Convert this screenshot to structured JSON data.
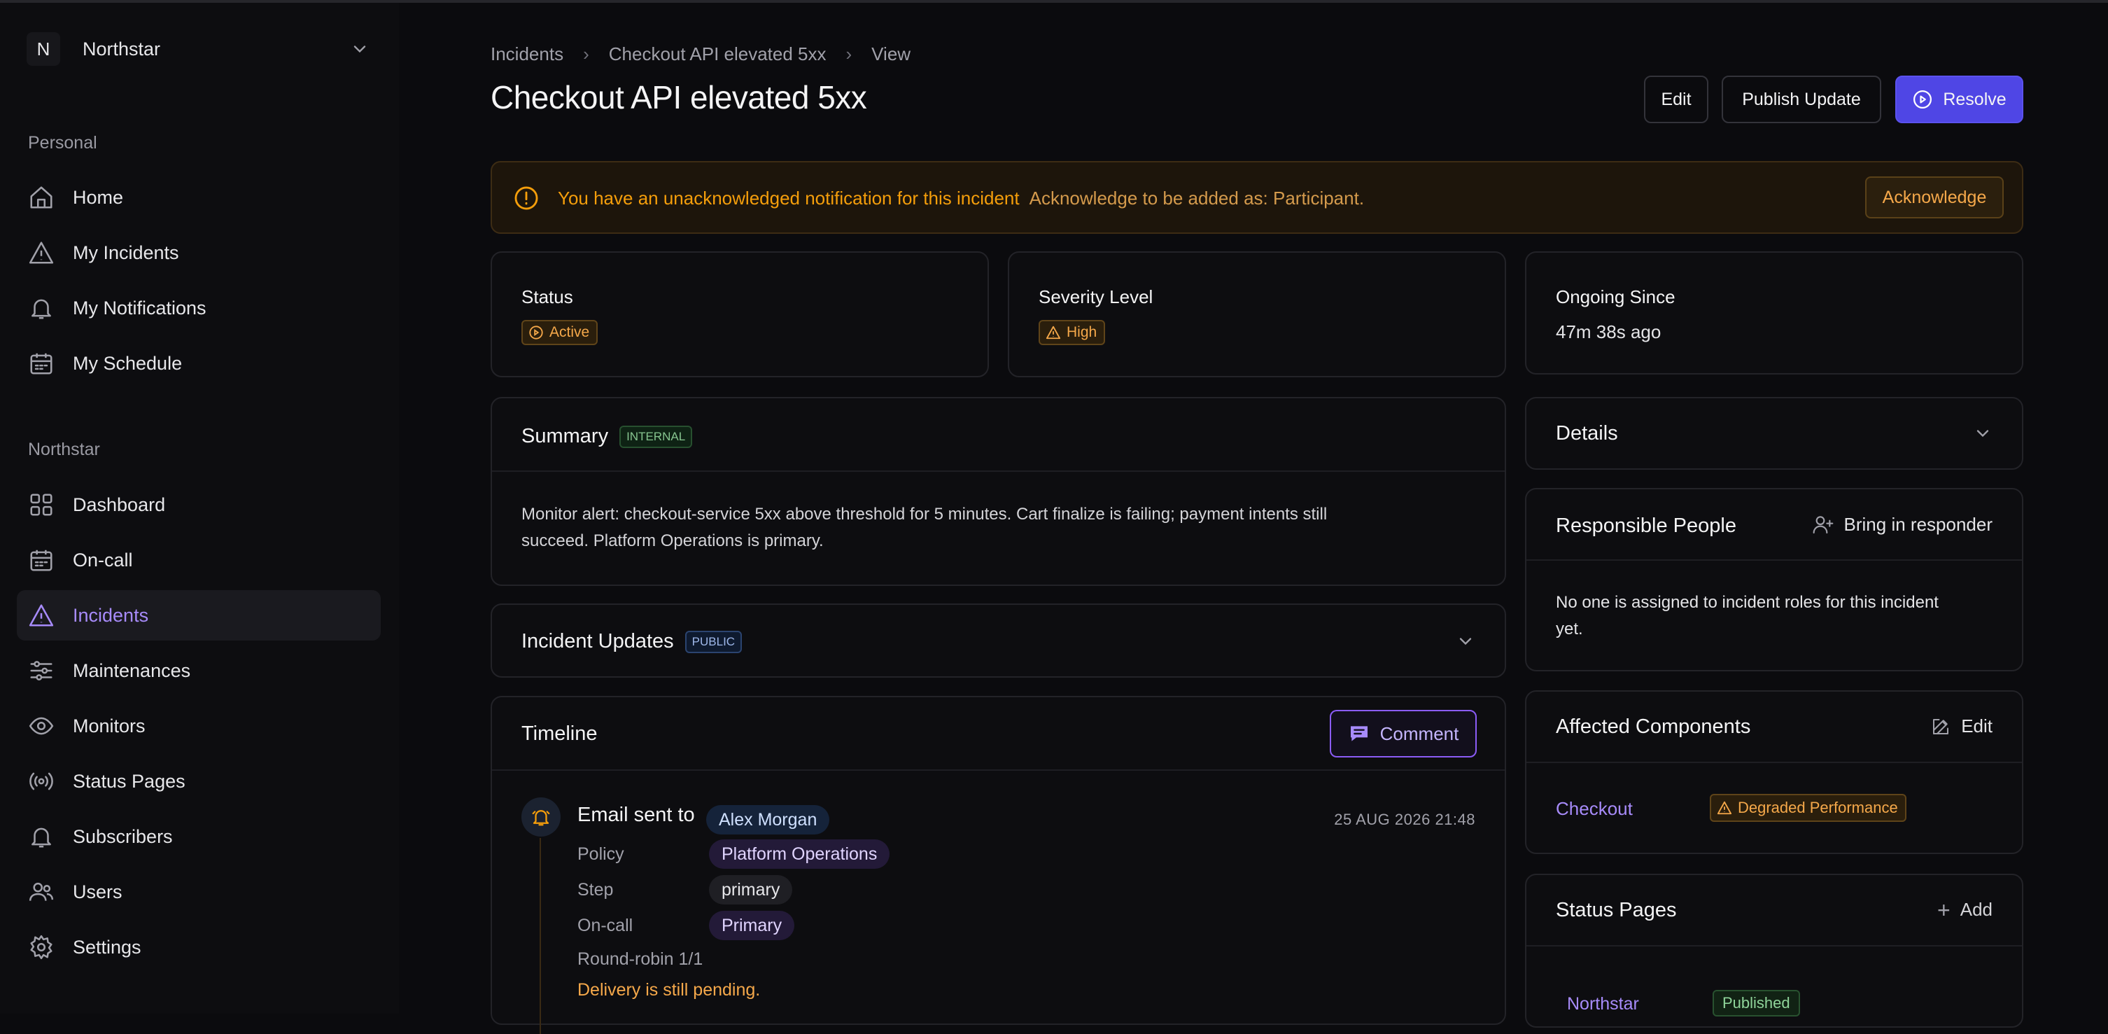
{
  "sidebar": {
    "org_initial": "N",
    "org_name": "Northstar",
    "personal_label": "Personal",
    "personal_items": [
      {
        "label": "Home",
        "icon": "home-icon"
      },
      {
        "label": "My Incidents",
        "icon": "warning-triangle-icon"
      },
      {
        "label": "My Notifications",
        "icon": "bell-icon"
      },
      {
        "label": "My Schedule",
        "icon": "calendar-icon"
      }
    ],
    "org_label": "Northstar",
    "org_items": [
      {
        "label": "Dashboard",
        "icon": "grid-icon"
      },
      {
        "label": "On-call",
        "icon": "calendar-icon"
      },
      {
        "label": "Incidents",
        "icon": "warning-triangle-icon",
        "active": true
      },
      {
        "label": "Maintenances",
        "icon": "sliders-icon"
      },
      {
        "label": "Monitors",
        "icon": "eye-icon"
      },
      {
        "label": "Status Pages",
        "icon": "broadcast-icon"
      },
      {
        "label": "Subscribers",
        "icon": "bell-icon"
      },
      {
        "label": "Users",
        "icon": "users-icon"
      },
      {
        "label": "Settings",
        "icon": "gear-icon"
      }
    ]
  },
  "breadcrumb": [
    "Incidents",
    "Checkout API elevated 5xx",
    "View"
  ],
  "header": {
    "title": "Checkout API elevated 5xx",
    "edit_label": "Edit",
    "publish_label": "Publish Update",
    "resolve_label": "Resolve"
  },
  "alert": {
    "message": "You have an unacknowledged notification for this incident",
    "detail": "Acknowledge to be added as: Participant.",
    "button": "Acknowledge"
  },
  "status": {
    "label": "Status",
    "value": "Active"
  },
  "severity": {
    "label": "Severity Level",
    "value": "High"
  },
  "ongoing": {
    "label": "Ongoing Since",
    "value": "47m 38s ago"
  },
  "summary": {
    "title": "Summary",
    "tag": "INTERNAL",
    "text_line1": "Monitor alert: checkout-service 5xx above threshold for 5 minutes. Cart finalize is failing; payment intents still",
    "text_line2": "succeed. Platform Operations is primary."
  },
  "updates": {
    "title": "Incident Updates",
    "tag": "PUBLIC"
  },
  "timeline": {
    "title": "Timeline",
    "comment_label": "Comment",
    "entry": {
      "heading": "Email sent to",
      "recipient": "Alex Morgan",
      "timestamp": "25 AUG 2026 21:48",
      "policy_label": "Policy",
      "policy_value": "Platform Operations",
      "step_label": "Step",
      "step_value": "primary",
      "oncall_label": "On-call",
      "oncall_value": "Primary",
      "round_robin": "Round-robin 1/1",
      "delivery": "Delivery is still pending."
    }
  },
  "details": {
    "title": "Details"
  },
  "responsible": {
    "title": "Responsible People",
    "action": "Bring in responder",
    "empty_line1": "No one is assigned to incident roles for this incident",
    "empty_line2": "yet."
  },
  "affected": {
    "title": "Affected Components",
    "action": "Edit",
    "component": "Checkout",
    "component_status": "Degraded Performance"
  },
  "status_pages": {
    "title": "Status Pages",
    "action": "Add",
    "page": "Northstar",
    "page_status": "Published"
  },
  "colors": {
    "accent": "#a78bfa",
    "primary_button": "#4f46e5",
    "warning": "#f59e0b"
  }
}
